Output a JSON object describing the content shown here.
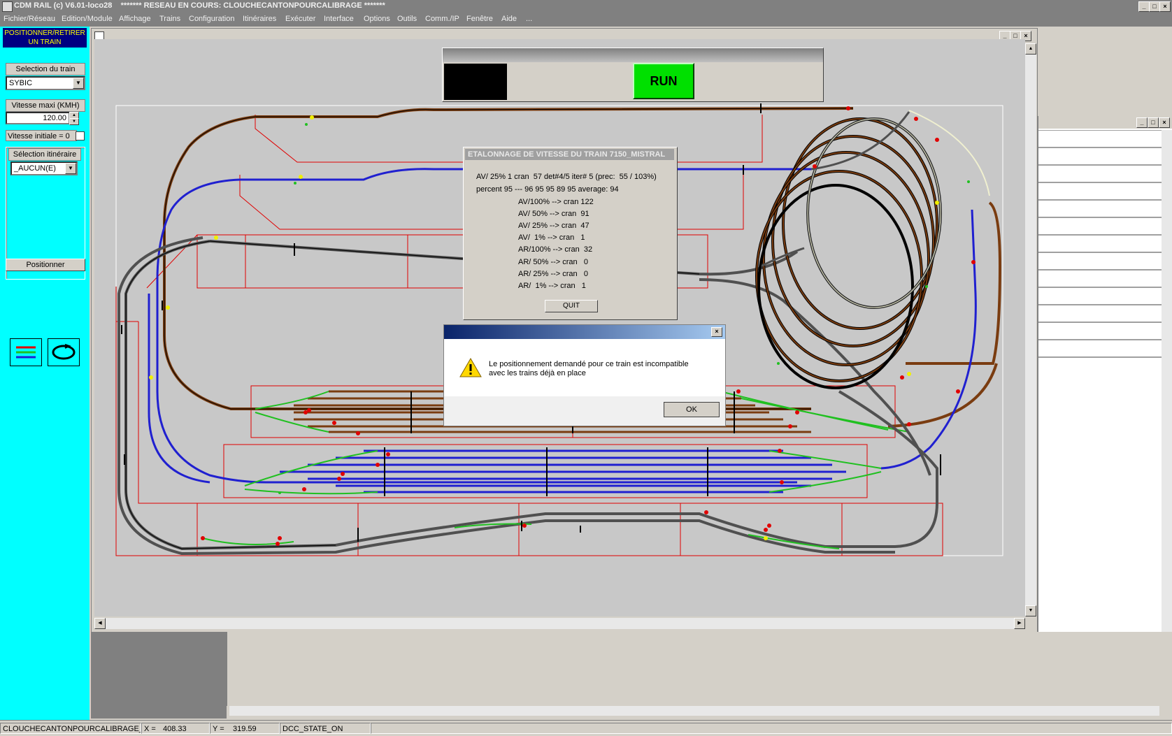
{
  "window": {
    "title": "CDM RAIL (c) V6.01-loco28    ******* RESEAU EN COURS: CLOUCHECANTONPOURCALIBRAGE *******",
    "min": "_",
    "max": "□",
    "close": "×"
  },
  "menu": [
    "Fichier/Réseau",
    "Edition/Module",
    "Affichage",
    "Trains",
    "Configuration",
    "Itinéraires",
    "Exécuter",
    "Interface",
    "Options",
    "Outils",
    "Comm./IP",
    "Fenêtre",
    "Aide",
    "..."
  ],
  "left": {
    "header": "POSITIONNER/RETIRER UN TRAIN",
    "train_label": "Selection du train",
    "train_value": "SYBIC",
    "speed_label": "Vitesse maxi (KMH)",
    "speed_value": "120.00",
    "init_speed_label": "Vitesse initiale = 0",
    "itin_label": "Sélection itinéraire",
    "itin_value": "_AUCUN(E)",
    "position_button": "Positionner"
  },
  "main": {
    "run_button": "RUN",
    "colors": {
      "run_green": "#00e000",
      "track_brown": "#7a3c10",
      "track_blue": "#2020d0",
      "track_gray": "#505050",
      "zone_red": "#e00000",
      "turnout_green": "#20c020"
    }
  },
  "calibration": {
    "title": "ETALONNAGE DE VITESSE DU TRAIN 7150_MISTRAL",
    "line1": "AV/ 25% 1 cran  57 det#4/5 iter# 5 (prec:  55 / 103%)",
    "line2": "percent 95 --- 96 95 95 89 95 average: 94",
    "rows": [
      "AV/100% --> cran 122",
      "AV/ 50% --> cran  91",
      "AV/ 25% --> cran  47",
      "AV/  1% --> cran   1",
      "AR/100% --> cran  32",
      "AR/ 50% --> cran   0",
      "AR/ 25% --> cran   0",
      "AR/  1% --> cran   1"
    ],
    "quit": "QUIT"
  },
  "alert": {
    "message": "Le positionnement demandé pour ce train est incompatible avec les trains déjà en place",
    "ok": "OK",
    "close": "×"
  },
  "status": {
    "network": "CLOUCHECANTONPOURCALIBRAGE_TOF",
    "x_label": "X =",
    "x_value": "408.33",
    "y_label": "Y =",
    "y_value": "319.59",
    "dcc": "DCC_STATE_ON"
  }
}
